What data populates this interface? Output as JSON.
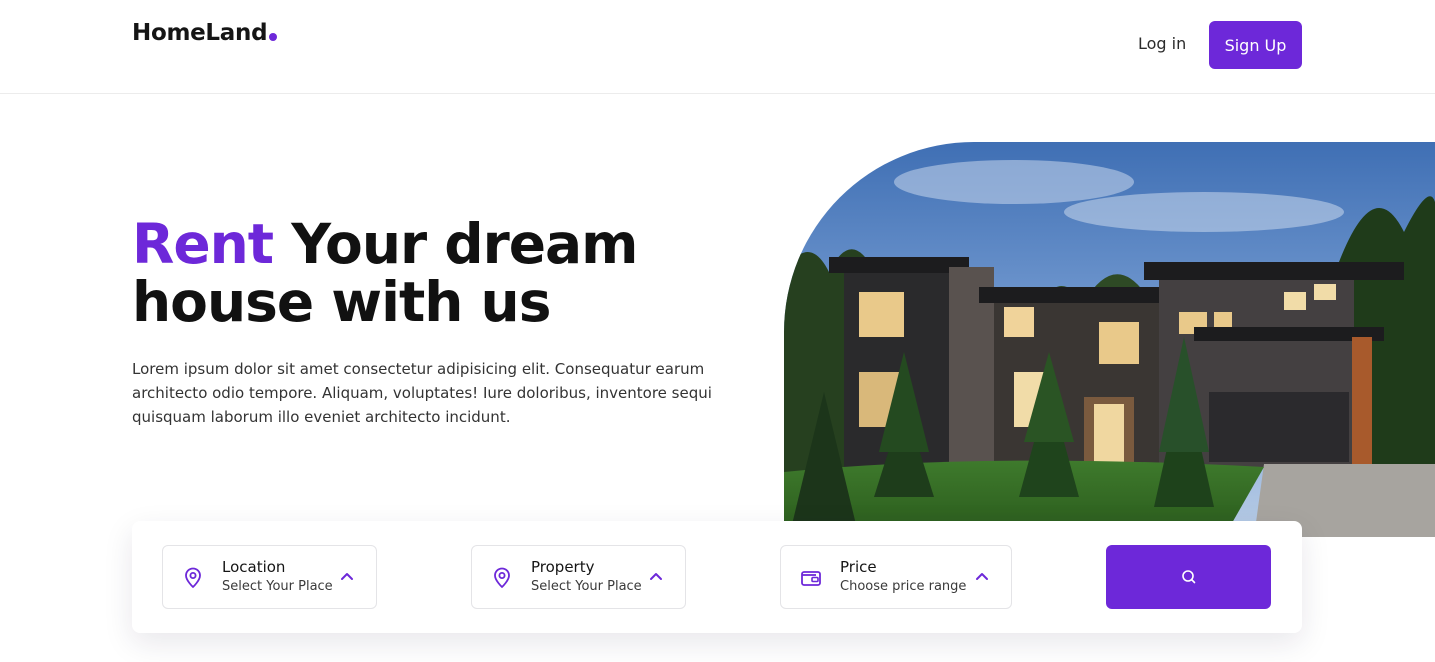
{
  "header": {
    "logo": "HomeLand",
    "login_label": "Log in",
    "signup_label": "Sign Up"
  },
  "hero": {
    "title_accent": "Rent",
    "title_rest": " Your dream house with us",
    "description": "Lorem ipsum dolor sit amet consectetur adipisicing elit. Consequatur earum architecto odio tempore. Aliquam, voluptates! Iure doloribus, inventore sequi quisquam laborum illo eveniet architecto incidunt."
  },
  "search": {
    "fields": [
      {
        "label": "Location",
        "sub": "Select Your Place",
        "icon": "map-pin-icon"
      },
      {
        "label": "Property",
        "sub": "Select Your Place",
        "icon": "map-pin-icon"
      },
      {
        "label": "Price",
        "sub": "Choose price range",
        "icon": "wallet-icon"
      }
    ],
    "button_icon": "search-icon"
  },
  "colors": {
    "accent": "#6d28d9",
    "text": "#111111",
    "border": "#e4e4e7"
  }
}
